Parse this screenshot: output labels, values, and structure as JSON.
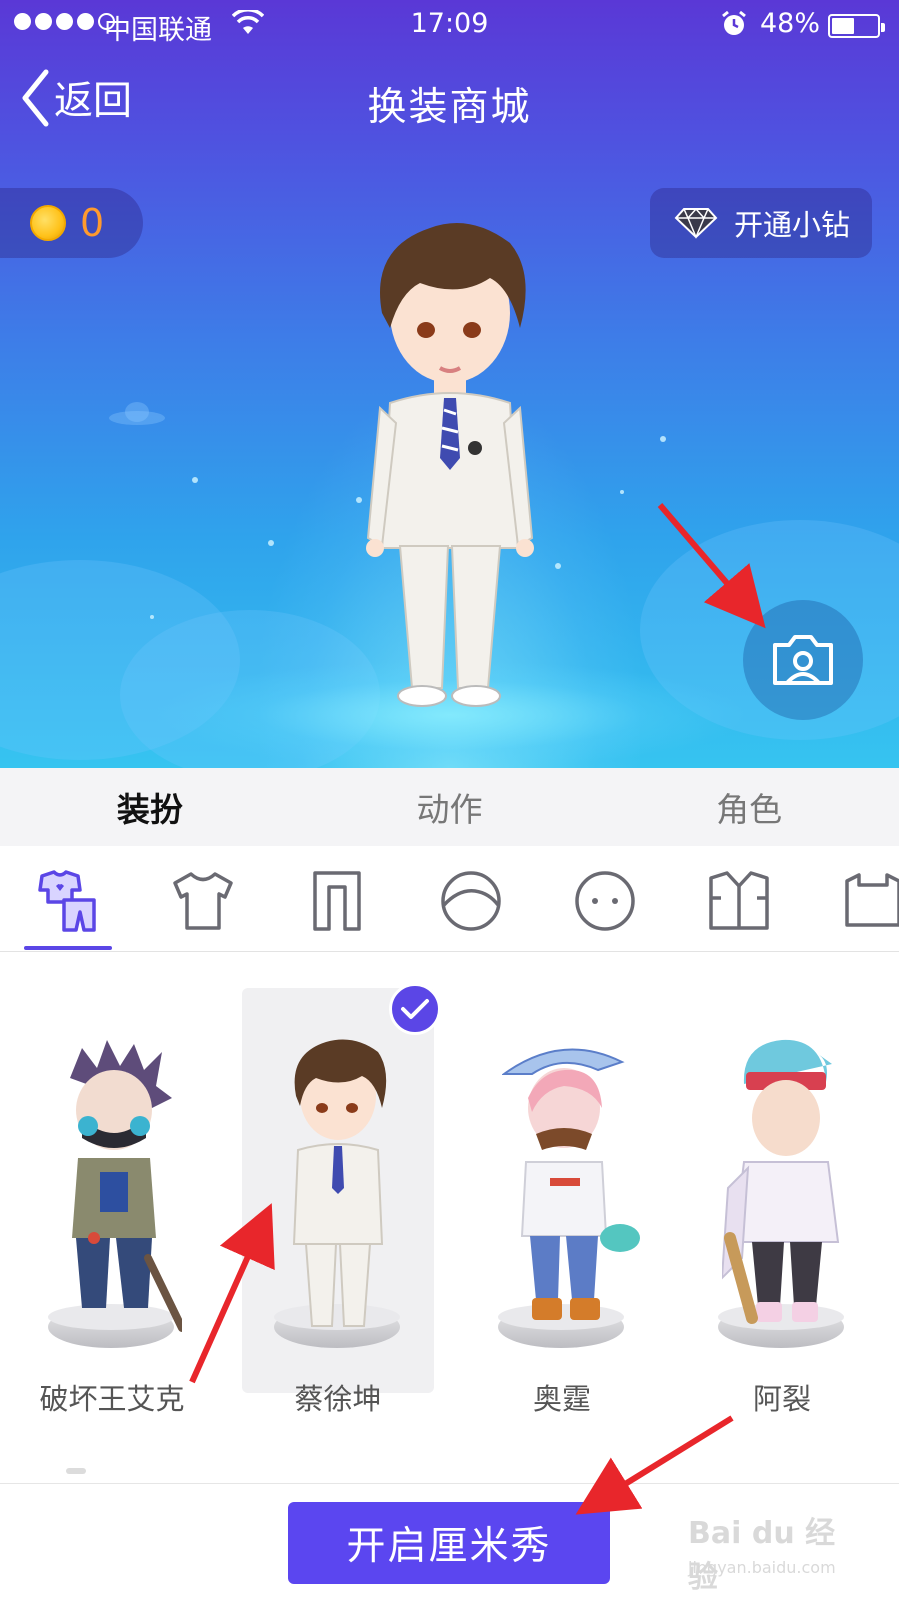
{
  "status_bar": {
    "carrier": "中国联通",
    "time": "17:09",
    "battery": "48%"
  },
  "nav": {
    "back_label": "返回",
    "title": "换装商城"
  },
  "wallet": {
    "coins": "0"
  },
  "vip_button": {
    "label": "开通小钻"
  },
  "tabs": [
    {
      "label": "装扮",
      "active": true
    },
    {
      "label": "动作",
      "active": false
    },
    {
      "label": "角色",
      "active": false
    }
  ],
  "categories": [
    {
      "icon": "outfit-set-icon",
      "active": true
    },
    {
      "icon": "shirt-icon",
      "active": false
    },
    {
      "icon": "pants-icon",
      "active": false
    },
    {
      "icon": "hair-icon",
      "active": false
    },
    {
      "icon": "face-icon",
      "active": false
    },
    {
      "icon": "jacket-icon",
      "active": false
    },
    {
      "icon": "top-icon",
      "active": false
    }
  ],
  "characters": [
    {
      "name": "破坏王艾克",
      "selected": false
    },
    {
      "name": "蔡徐坤",
      "selected": true
    },
    {
      "name": "奥霆",
      "selected": false
    },
    {
      "name": "阿裂",
      "selected": false
    }
  ],
  "primary_action": {
    "label": "开启厘米秀"
  },
  "watermark": {
    "logo": "Bai du 经验",
    "url": "jingyan.baidu.com"
  },
  "colors": {
    "accent": "#5b46f0",
    "coin_text": "#ff9a2e",
    "annotation": "#e8262b"
  }
}
